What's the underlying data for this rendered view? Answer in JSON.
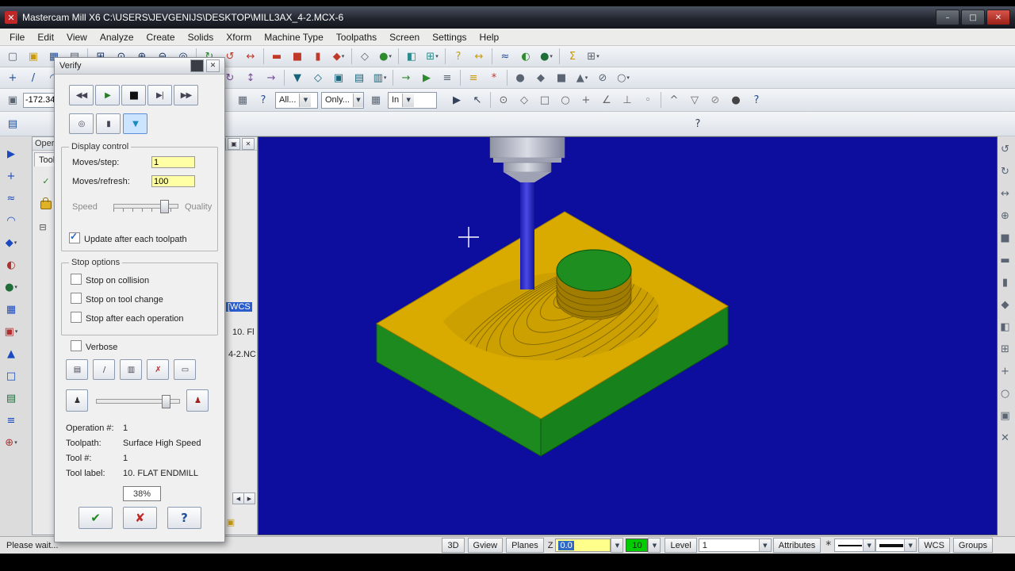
{
  "titlebar": {
    "title": "Mastercam Mill X6  C:\\USERS\\JEVGENIJS\\DESKTOP\\MILL3AX_4-2.MCX-6",
    "min": "–",
    "max": "□",
    "close": "✕",
    "logo": "✕"
  },
  "menubar": [
    "File",
    "Edit",
    "View",
    "Analyze",
    "Create",
    "Solids",
    "Xform",
    "Machine Type",
    "Toolpaths",
    "Screen",
    "Settings",
    "Help"
  ],
  "coord": {
    "value": "-172.34"
  },
  "combos": {
    "all": "All...",
    "only": "Only...",
    "in": "In"
  },
  "toolbars": {
    "row1": [
      {
        "n": "new-file-icon",
        "g": "▢",
        "c": "#5a6472"
      },
      {
        "n": "open-file-icon",
        "g": "▣",
        "c": "#c89a10"
      },
      {
        "n": "save-file-icon",
        "g": "▦",
        "c": "#1f4e9c"
      },
      {
        "n": "print-icon",
        "g": "▤",
        "c": "#5a6472"
      },
      {
        "sep": true
      },
      {
        "n": "zoom-window-icon",
        "g": "⊞",
        "c": "#1f3a66"
      },
      {
        "n": "zoom-target-icon",
        "g": "⊙",
        "c": "#1f3a66"
      },
      {
        "n": "zoom-in-icon",
        "g": "⊕",
        "c": "#1f3a66"
      },
      {
        "n": "zoom-out-icon",
        "g": "⊖",
        "c": "#1f3a66"
      },
      {
        "n": "fit-screen-icon",
        "g": "◎",
        "c": "#1f3a66"
      },
      {
        "sep": true
      },
      {
        "n": "repaint-icon",
        "g": "↻",
        "c": "#2e8b2e"
      },
      {
        "n": "dynamic-rotate-icon",
        "g": "↺",
        "c": "#c03a2b"
      },
      {
        "n": "pan-icon",
        "g": "↔",
        "c": "#c03a2b"
      },
      {
        "sep": true
      },
      {
        "n": "gview-top-icon",
        "g": "▬",
        "c": "#c03a2b"
      },
      {
        "n": "gview-front-icon",
        "g": "■",
        "c": "#c03a2b"
      },
      {
        "n": "gview-side-icon",
        "g": "▮",
        "c": "#c03a2b"
      },
      {
        "n": "gview-isometric-icon",
        "g": "◆",
        "c": "#c03a2b",
        "dd": true
      },
      {
        "sep": true
      },
      {
        "n": "wireframe-icon",
        "g": "◇",
        "c": "#5a6472"
      },
      {
        "n": "shaded-icon",
        "g": "●",
        "c": "#2e8b2e",
        "dd": true
      },
      {
        "sep": true
      },
      {
        "n": "plane-select-icon",
        "g": "◧",
        "c": "#2e8b8b"
      },
      {
        "n": "wcs-icon",
        "g": "⊞",
        "c": "#2e8b8b",
        "dd": true
      },
      {
        "sep": true
      },
      {
        "n": "analyze-entity-icon",
        "g": "?",
        "c": "#c89a10"
      },
      {
        "n": "analyze-distance-icon",
        "g": "↔",
        "c": "#c89a10"
      },
      {
        "sep": true
      },
      {
        "n": "curve-create-icon",
        "g": "≈",
        "c": "#1f4e9c"
      },
      {
        "n": "surface-create-icon",
        "g": "◐",
        "c": "#2e8b2e"
      },
      {
        "n": "solid-create-icon",
        "g": "●",
        "c": "#1f6e3a",
        "dd": true
      },
      {
        "sep": true
      },
      {
        "n": "sigma-icon",
        "g": "Σ",
        "c": "#c89a10"
      },
      {
        "n": "grid-icon",
        "g": "⊞",
        "c": "#5a6472",
        "dd": true
      }
    ],
    "row2": [
      {
        "n": "create-point-icon",
        "g": "+",
        "c": "#1f4e9c"
      },
      {
        "n": "create-line-icon",
        "g": "/",
        "c": "#1f4e9c"
      },
      {
        "n": "create-arc-icon",
        "g": "◠",
        "c": "#1f4e9c"
      },
      {
        "n": "create-spline-icon",
        "g": "≈",
        "c": "#1f4e9c"
      },
      {
        "n": "create-rectangle-icon",
        "g": "□",
        "c": "#1f4e9c"
      },
      {
        "n": "create-fillet-icon",
        "g": "◞",
        "c": "#1f4e9c"
      },
      {
        "n": "create-chamfer-icon",
        "g": "◣",
        "c": "#1f4e9c"
      },
      {
        "sep": true
      },
      {
        "n": "trim-icon",
        "g": "⊣",
        "c": "#7a4a9c"
      },
      {
        "n": "delete-icon",
        "g": "✗",
        "c": "#c03a2b"
      },
      {
        "sep": true
      },
      {
        "n": "xform-mirror-icon",
        "g": "◧",
        "c": "#7a4a9c"
      },
      {
        "n": "xform-rotate-icon",
        "g": "↻",
        "c": "#7a4a9c"
      },
      {
        "n": "xform-scale-icon",
        "g": "↕",
        "c": "#7a4a9c"
      },
      {
        "n": "xform-offset-icon",
        "g": "→",
        "c": "#7a4a9c"
      },
      {
        "sep": true
      },
      {
        "n": "toolpath-drill-icon",
        "g": "▼",
        "c": "#18647a"
      },
      {
        "n": "toolpath-contour-icon",
        "g": "◇",
        "c": "#18647a"
      },
      {
        "n": "toolpath-pocket-icon",
        "g": "▣",
        "c": "#18647a"
      },
      {
        "n": "surface-rough-icon",
        "g": "▤",
        "c": "#18647a"
      },
      {
        "n": "surface-finish-icon",
        "g": "▥",
        "c": "#18647a",
        "dd": true
      },
      {
        "sep": true
      },
      {
        "n": "backplot-icon",
        "g": "→",
        "c": "#2e8b2e"
      },
      {
        "n": "verify-toolpath-icon",
        "g": "▶",
        "c": "#2e8b2e"
      },
      {
        "n": "post-process-icon",
        "g": "≡",
        "c": "#5a6472"
      },
      {
        "sep": true
      },
      {
        "n": "levels-icon",
        "g": "≡",
        "c": "#c89a10"
      },
      {
        "n": "attributes-icon",
        "g": "*",
        "c": "#c03a2b"
      },
      {
        "sep": true
      },
      {
        "n": "utility-icon-1",
        "g": "●",
        "c": "#5a6472"
      },
      {
        "n": "utility-icon-2",
        "g": "◆",
        "c": "#5a6472"
      },
      {
        "n": "utility-icon-3",
        "g": "■",
        "c": "#5a6472"
      },
      {
        "n": "utility-icon-4",
        "g": "▲",
        "c": "#5a6472",
        "dd": true
      },
      {
        "n": "utility-icon-5",
        "g": "⊘",
        "c": "#5a6472"
      },
      {
        "n": "utility-icon-6",
        "g": "○",
        "c": "#5a6472",
        "dd": true
      }
    ],
    "row3a": [
      {
        "n": "gview-select-icon",
        "g": "▣",
        "c": "#5a6472"
      }
    ],
    "row3b": [
      {
        "n": "fastpoint-icon",
        "g": "+",
        "c": "#2e8b2e"
      },
      {
        "n": "prompt-icon",
        "g": "!",
        "c": "#c89a10"
      },
      {
        "n": "grid-settings-icon",
        "g": "▦",
        "c": "#5a6472"
      },
      {
        "n": "entry-help-icon",
        "g": "?",
        "c": "#1f4e9c"
      }
    ],
    "row3c": [
      {
        "n": "selection-mode-icon",
        "g": "▦",
        "c": "#5a6472"
      }
    ],
    "row3d": [
      {
        "n": "select-last-icon",
        "g": "▶",
        "c": "#33415a"
      },
      {
        "n": "select-window-icon",
        "g": "↖",
        "c": "#33415a"
      },
      {
        "sep": true
      },
      {
        "n": "snap-origin-icon",
        "g": "⊙",
        "c": "#666666"
      },
      {
        "n": "snap-midpoint-icon",
        "g": "◇",
        "c": "#666666"
      },
      {
        "n": "snap-endpoint-icon",
        "g": "□",
        "c": "#666666"
      },
      {
        "n": "snap-center-icon",
        "g": "○",
        "c": "#666666"
      },
      {
        "n": "snap-intersection-icon",
        "g": "+",
        "c": "#666666"
      },
      {
        "n": "snap-angle-icon",
        "g": "∠",
        "c": "#666666"
      },
      {
        "n": "snap-perpendicular-icon",
        "g": "⊥",
        "c": "#666666"
      },
      {
        "n": "snap-tangent-icon",
        "g": "◦",
        "c": "#666666"
      },
      {
        "sep": true
      },
      {
        "n": "select-chain-icon",
        "g": "^",
        "c": "#666666"
      },
      {
        "n": "select-invert-icon",
        "g": "▽",
        "c": "#666666"
      },
      {
        "n": "select-none-icon",
        "g": "⊘",
        "c": "#888888"
      },
      {
        "n": "select-solids-icon",
        "g": "●",
        "c": "#444444"
      },
      {
        "n": "selection-help-icon",
        "g": "?",
        "c": "#1f4e9c"
      }
    ],
    "row4a": [
      {
        "n": "mru-functions-icon",
        "g": "▤",
        "c": "#1f4e9c"
      }
    ],
    "row4b": [
      {
        "n": "general-help-icon",
        "g": "?",
        "c": "#33415a"
      }
    ],
    "left": [
      {
        "n": "analyze-cursor-icon",
        "g": "▶",
        "c": "#1a4ac0"
      },
      {
        "n": "sketcher-icon",
        "g": "+",
        "c": "#1a4ac0"
      },
      {
        "n": "curve-tool-icon",
        "g": "≈",
        "c": "#1a4ac0"
      },
      {
        "n": "arc-tool-icon",
        "g": "◠",
        "c": "#1a4ac0"
      },
      {
        "n": "drafting-icon",
        "g": "◆",
        "c": "#1a4ac0",
        "dd": true
      },
      {
        "n": "surface-tool-icon",
        "g": "◐",
        "c": "#b03030"
      },
      {
        "n": "solid-tool-icon",
        "g": "●",
        "c": "#1f6e3a",
        "dd": true
      },
      {
        "n": "mesh-icon",
        "g": "▦",
        "c": "#1a4ac0"
      },
      {
        "n": "rect-tool-icon",
        "g": "▣",
        "c": "#b03030",
        "dd": true
      },
      {
        "n": "text-tool-icon",
        "g": "▲",
        "c": "#1a4ac0"
      },
      {
        "n": "bounding-box-icon",
        "g": "□",
        "c": "#1a4ac0"
      },
      {
        "n": "pattern-icon",
        "g": "▤",
        "c": "#1f6e3a"
      },
      {
        "n": "relief-icon",
        "g": "≡",
        "c": "#1a4ac0"
      },
      {
        "n": "gear-tool-icon",
        "g": "⊕",
        "c": "#b03030",
        "dd": true
      }
    ],
    "right": [
      {
        "n": "viewport-rotate-x-icon",
        "g": "↺",
        "c": "#5a6472"
      },
      {
        "n": "viewport-rotate-y-icon",
        "g": "↻",
        "c": "#5a6472"
      },
      {
        "n": "viewport-pan-icon",
        "g": "↔",
        "c": "#5a6472"
      },
      {
        "n": "viewport-zoom-icon",
        "g": "⊕",
        "c": "#5a6472"
      },
      {
        "n": "view-top-icon",
        "g": "■",
        "c": "#5a6472"
      },
      {
        "n": "view-front-icon",
        "g": "▬",
        "c": "#5a6472"
      },
      {
        "n": "view-right-icon",
        "g": "▮",
        "c": "#5a6472"
      },
      {
        "n": "view-iso-icon",
        "g": "◆",
        "c": "#5a6472"
      },
      {
        "n": "section-view-icon",
        "g": "◧",
        "c": "#5a6472"
      },
      {
        "n": "grid-toggle-icon",
        "g": "⊞",
        "c": "#5a6472"
      },
      {
        "n": "axes-toggle-icon",
        "g": "+",
        "c": "#5a6472"
      },
      {
        "n": "light-icon",
        "g": "○",
        "c": "#5a6472"
      },
      {
        "n": "camera-icon",
        "g": "▣",
        "c": "#5a6472"
      },
      {
        "n": "capture-icon",
        "g": "✕",
        "c": "#5a6472"
      }
    ]
  },
  "ops_panel": {
    "caption": "Oper...",
    "tab": "Tool...",
    "btns": {
      "collapse": "▾",
      "float": "▣",
      "close": "✕"
    },
    "check_icon": "✓",
    "tree_node": "⊟",
    "tree": [
      "[WCS",
      "10. Fl",
      "4-2.NC"
    ],
    "scroll_left": "◀",
    "scroll_right": "▶",
    "help_icon": "?",
    "folder_icon": "▣"
  },
  "verify": {
    "title": "Verify",
    "pin": "■",
    "close": "✕",
    "icons": {
      "rewind": "◀◀",
      "play": "▶",
      "stop": "■",
      "step": "▶|",
      "ffwd": "▶▶",
      "mode1": "◎",
      "mode2": "▮",
      "mode3": "▼",
      "act1": "▤",
      "act2": "/",
      "act3": "▥",
      "act4": "✗",
      "act5": "▭",
      "person": "♟",
      "runner": "♟",
      "ok": "✔",
      "cancel": "✘",
      "help": "?"
    },
    "display": {
      "group": "Display control",
      "moves_step": "Moves/step:",
      "moves_step_value": "1",
      "moves_refresh": "Moves/refresh:",
      "moves_refresh_value": "100",
      "speed": "Speed",
      "quality": "Quality",
      "update_each": "Update after each toolpath"
    },
    "stop": {
      "group": "Stop options",
      "collision": "Stop on collision",
      "tool_change": "Stop on tool change",
      "each_operation": "Stop after each operation"
    },
    "verbose": "Verbose",
    "details": {
      "operation_label": "Operation #:",
      "operation": "1",
      "toolpath_label": "Toolpath:",
      "toolpath": "Surface High Speed",
      "tool_label": "Tool #:",
      "tool": "1",
      "tool_name_label": "Tool label:",
      "tool_name": "10. FLAT ENDMILL"
    },
    "progress": "38%"
  },
  "statusbar": {
    "message": "Please wait...",
    "btn_3d": "3D",
    "gview": "Gview",
    "planes": "Planes",
    "z": "Z",
    "z_value": "0.0",
    "color": "10",
    "level": "Level",
    "level_value": "1",
    "attributes": "Attributes",
    "point_style": "*",
    "wcs": "WCS",
    "groups": "Groups"
  },
  "scene": {
    "viewport_color": "#0d0d9e",
    "stock_top": "#d9ab00",
    "stock_side": "#1d8a1f",
    "tool_shaft": "#2a2ac8",
    "holder": "#b4b6c2"
  }
}
